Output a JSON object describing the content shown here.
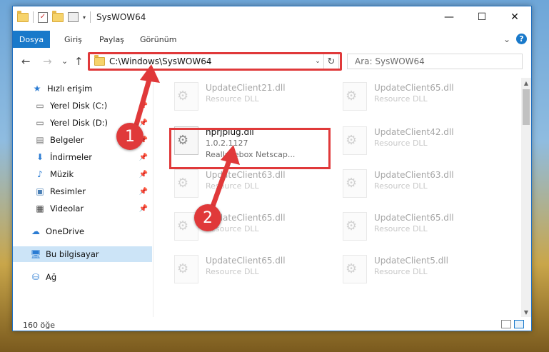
{
  "window": {
    "title": "SysWOW64",
    "qat_dropdown": "▾",
    "minimize": "—",
    "maximize": "☐",
    "close": "✕"
  },
  "ribbon": {
    "tabs": [
      "Dosya",
      "Giriş",
      "Paylaş",
      "Görünüm"
    ],
    "expand": "⌄",
    "help": "?"
  },
  "nav": {
    "back": "←",
    "forward": "→",
    "recent": "⌄",
    "up": "↑",
    "address": "C:\\Windows\\SysWOW64",
    "address_dropdown": "⌄",
    "refresh": "↻",
    "search_placeholder": "Ara: SysWOW64"
  },
  "sidebar": {
    "items": [
      {
        "label": "Hızlı erişim",
        "icon": "star-icon"
      },
      {
        "label": "Yerel Disk (C:)",
        "icon": "drive-icon"
      },
      {
        "label": "Yerel Disk (D:)",
        "icon": "drive-icon"
      },
      {
        "label": "Belgeler",
        "icon": "documents-icon"
      },
      {
        "label": "İndirmeler",
        "icon": "download-icon"
      },
      {
        "label": "Müzik",
        "icon": "music-icon"
      },
      {
        "label": "Resimler",
        "icon": "pictures-icon"
      },
      {
        "label": "Videolar",
        "icon": "videos-icon"
      },
      {
        "label": "OneDrive",
        "icon": "cloud-icon"
      },
      {
        "label": "Bu bilgisayar",
        "icon": "computer-icon"
      },
      {
        "label": "Ağ",
        "icon": "network-icon"
      }
    ]
  },
  "files": {
    "left": [
      {
        "name": "UpdateClient21.dll",
        "meta1": "Resource DLL",
        "meta2": ""
      },
      {
        "name": "nprjplug.dll",
        "meta1": "1.0.2.1127",
        "meta2": "RealJukebox Netscap..."
      },
      {
        "name": "UpdateClient63.dll",
        "meta1": "Resource DLL",
        "meta2": ""
      },
      {
        "name": "UpdateClient65.dll",
        "meta1": "Resource DLL",
        "meta2": ""
      },
      {
        "name": "UpdateClient65.dll",
        "meta1": "Resource DLL",
        "meta2": ""
      }
    ],
    "right": [
      {
        "name": "UpdateClient65.dll",
        "meta1": "Resource DLL"
      },
      {
        "name": "UpdateClient42.dll",
        "meta1": "Resource DLL"
      },
      {
        "name": "UpdateClient63.dll",
        "meta1": "Resource DLL"
      },
      {
        "name": "UpdateClient65.dll",
        "meta1": "Resource DLL"
      },
      {
        "name": "UpdateClient5.dll",
        "meta1": "Resource DLL"
      }
    ]
  },
  "status": {
    "count": "160 öğe"
  },
  "annotations": {
    "step1": "1",
    "step2": "2",
    "color": "#e0393a"
  }
}
